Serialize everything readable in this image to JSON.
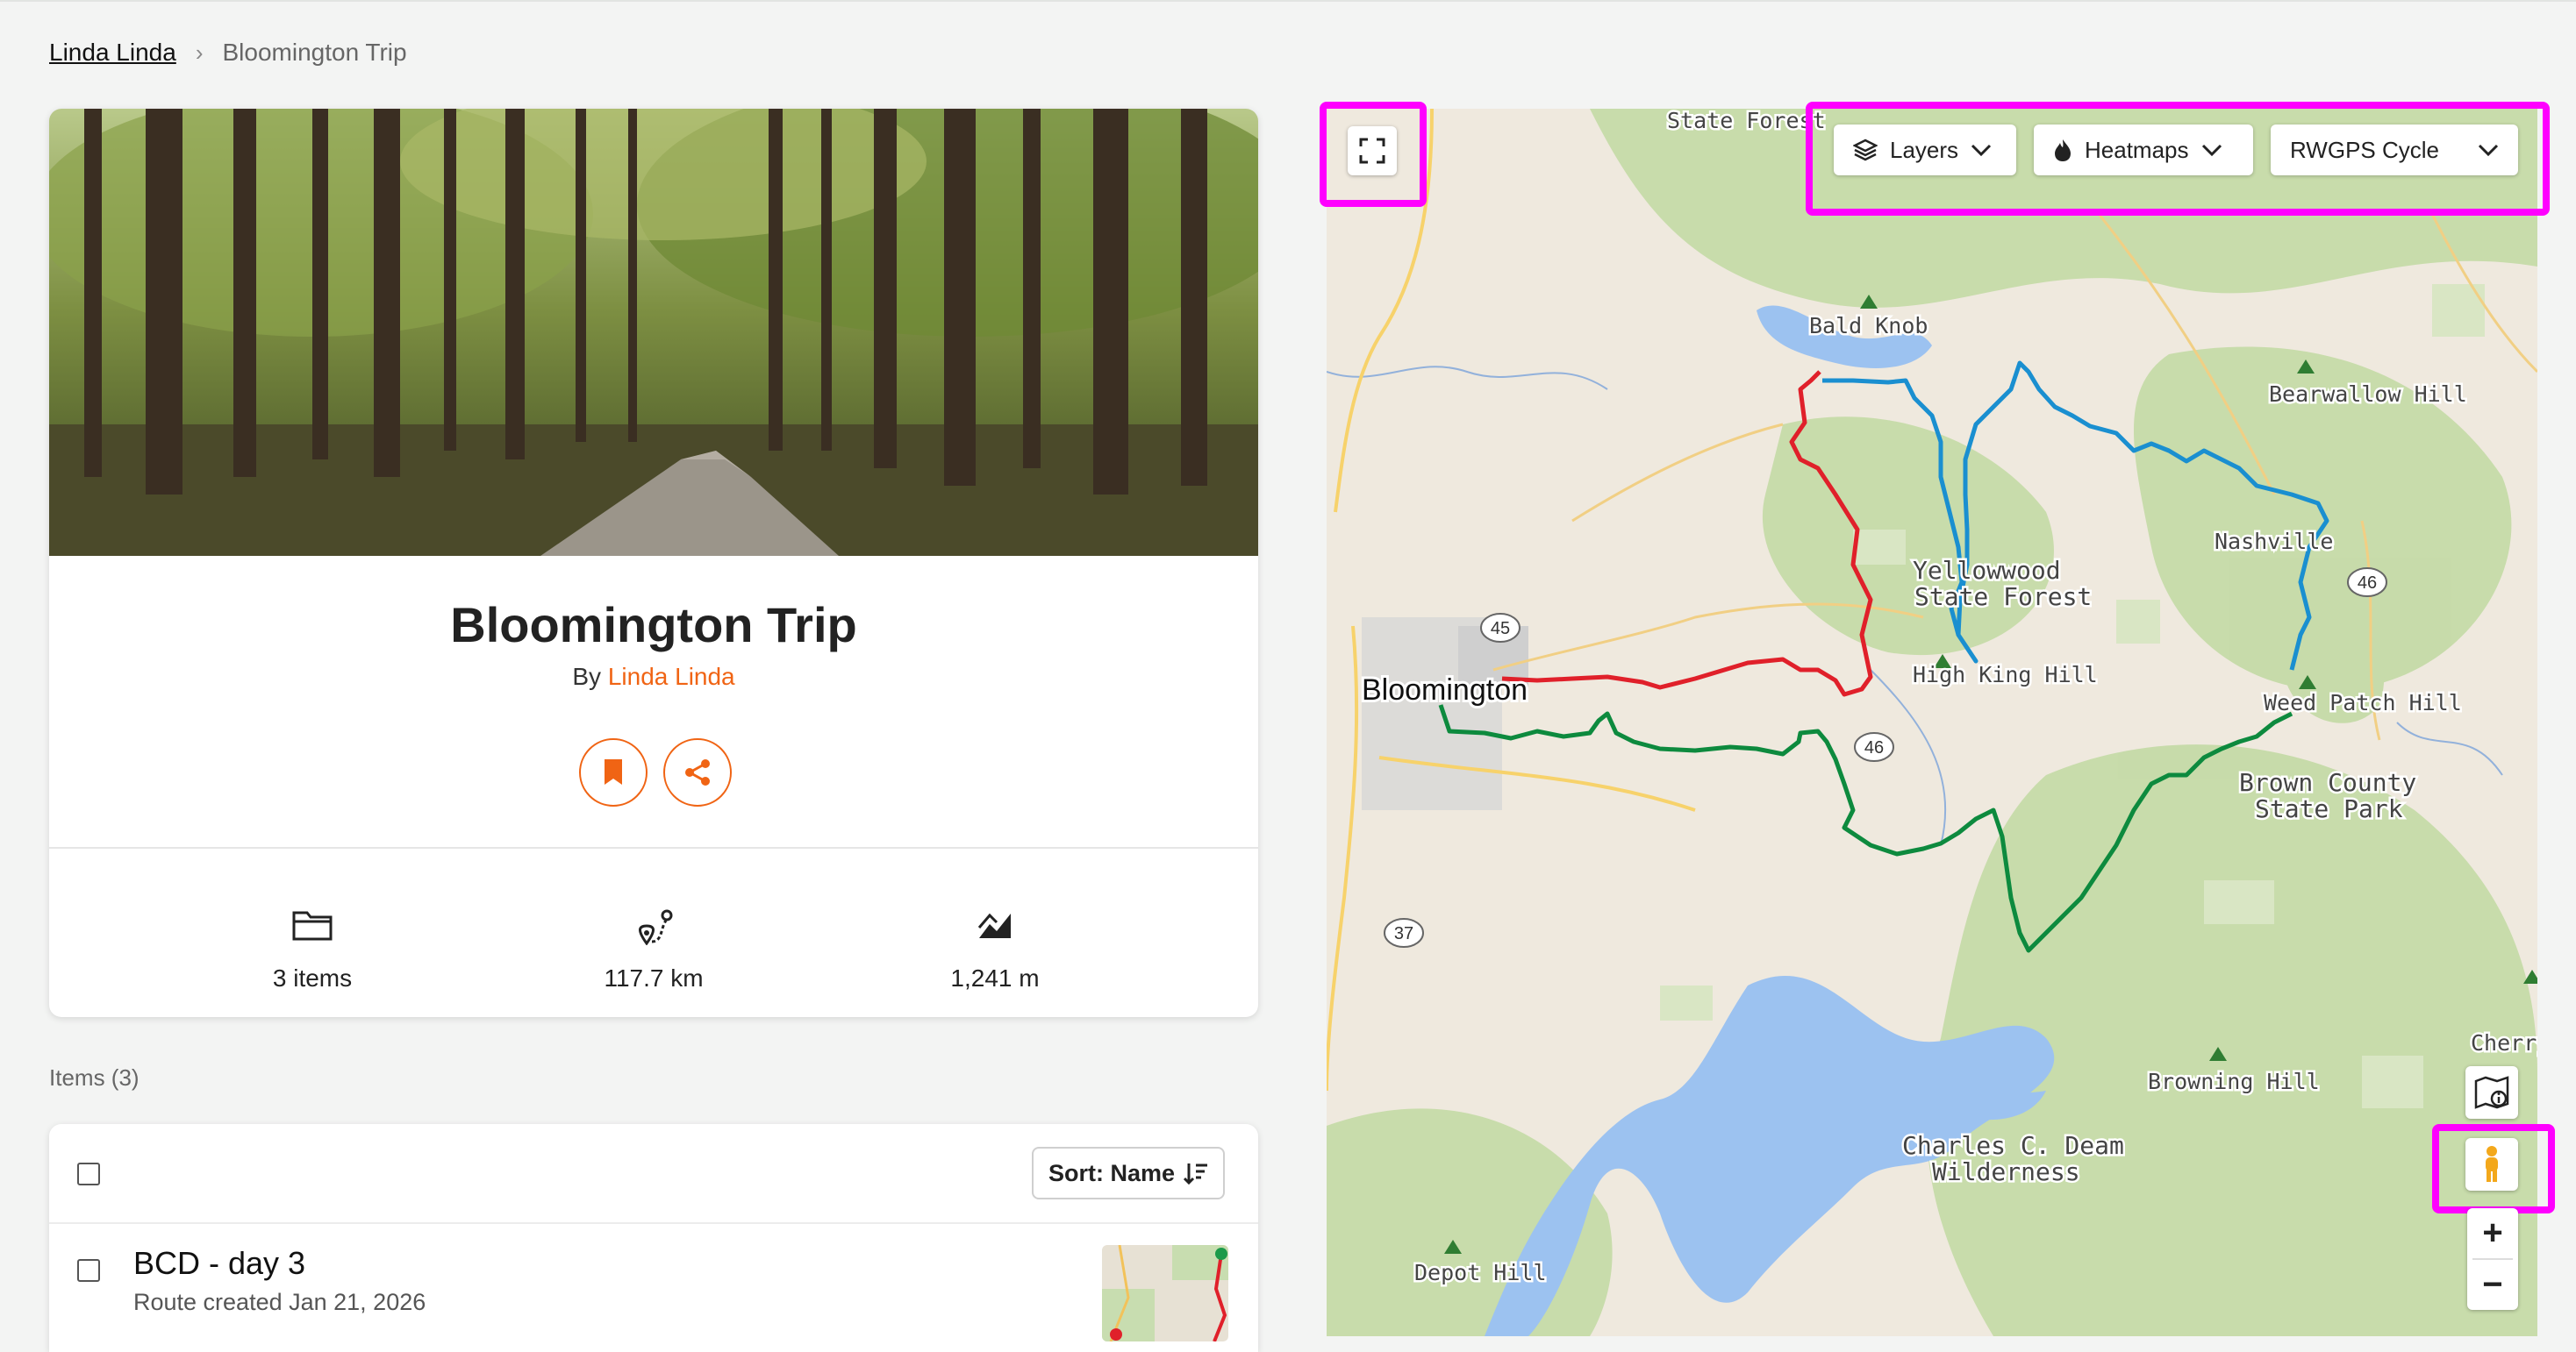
{
  "breadcrumb": {
    "user": "Linda Linda",
    "separator": "›",
    "current": "Bloomington Trip"
  },
  "collection": {
    "title": "Bloomington Trip",
    "by_prefix": "By",
    "author": "Linda Linda",
    "actions": {
      "bookmark_icon": "bookmark-icon",
      "share_icon": "share-icon"
    }
  },
  "stats": [
    {
      "icon": "folder-icon",
      "value": "3 items"
    },
    {
      "icon": "route-distance-icon",
      "value": "117.7 km"
    },
    {
      "icon": "elevation-icon",
      "value": "1,241 m"
    }
  ],
  "items": {
    "header": "Items (3)",
    "sort_label": "Sort: Name",
    "rows": [
      {
        "title": "BCD - day 3",
        "subtitle": "Route created Jan 21, 2026"
      }
    ]
  },
  "map": {
    "controls": {
      "layers": "Layers",
      "heatmaps": "Heatmaps",
      "basemap": "RWGPS Cycle"
    },
    "labels": {
      "state_forest_top": "State Forest",
      "bald_knob": "Bald Knob",
      "bearwallow_hill": "Bearwallow Hill",
      "nashville": "Nashville",
      "yellowwood_1": "Yellowwood",
      "yellowwood_2": "State Forest",
      "high_king_hill": "High King Hill",
      "bloomington": "Bloomington",
      "weed_patch_hill": "Weed Patch Hill",
      "brown_county_1": "Brown County",
      "brown_county_2": "State Park",
      "cherry": "Cherry",
      "browning_hill": "Browning Hill",
      "charles_deam_1": "Charles C. Deam",
      "charles_deam_2": "Wilderness",
      "depot_hill": "Depot Hill"
    },
    "road_shields": {
      "r45": "45",
      "r46a": "46",
      "r46b": "46",
      "r37": "37"
    },
    "route_colors": {
      "red": "#e0202a",
      "blue": "#1a8fd0",
      "green": "#0d8a3e"
    },
    "highlight_color": "#ff00ff"
  }
}
